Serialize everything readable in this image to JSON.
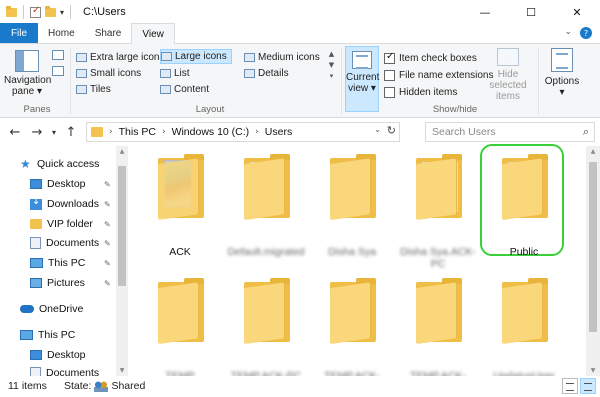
{
  "window": {
    "title": "C:\\Users",
    "minimize_glyph": "—",
    "maximize_glyph": "☐",
    "close_glyph": "✕"
  },
  "ribbon_tabs": [
    "File",
    "Home",
    "Share",
    "View"
  ],
  "active_tab": "View",
  "accent_color": "#1979ca",
  "ribbon": {
    "panes": {
      "nav_pane_label": "Navigation pane ▾",
      "group_label": "Panes"
    },
    "layout": {
      "group_label": "Layout",
      "options": [
        "Extra large icons",
        "Large icons",
        "Medium icons",
        "Small icons",
        "List",
        "Details",
        "Tiles",
        "Content"
      ],
      "selected": "Large icons"
    },
    "current_view": {
      "label": "Current view ▾"
    },
    "show_hide": {
      "group_label": "Show/hide",
      "item_check_boxes": "Item check boxes",
      "item_check_boxes_checked": true,
      "file_name_extensions": "File name extensions",
      "file_name_extensions_checked": false,
      "hidden_items": "Hidden items",
      "hidden_items_checked": false,
      "hide_selected_label": "Hide selected items"
    },
    "options_label": "Options ▾"
  },
  "address": {
    "crumbs": [
      "This PC",
      "Windows 10 (C:)",
      "Users"
    ],
    "back_glyph": "←",
    "forward_glyph": "→",
    "recent_glyph": "▾",
    "up_glyph": "↑",
    "search_placeholder": "Search Users"
  },
  "nav_tree": {
    "items": [
      {
        "label": "Quick access",
        "icon": "star-icon"
      },
      {
        "label": "Desktop",
        "icon": "desktop-icon",
        "pinned": true
      },
      {
        "label": "Downloads",
        "icon": "downloads-icon",
        "pinned": true
      },
      {
        "label": "VIP folder",
        "icon": "folder-icon",
        "pinned": true
      },
      {
        "label": "Documents",
        "icon": "documents-icon",
        "pinned": true
      },
      {
        "label": "This PC",
        "icon": "computer-icon",
        "pinned": true
      },
      {
        "label": "Pictures",
        "icon": "pictures-icon",
        "pinned": true
      },
      {
        "label": "OneDrive",
        "icon": "onedrive-icon"
      },
      {
        "label": "This PC",
        "icon": "computer-icon"
      },
      {
        "label": "Desktop",
        "icon": "desktop-icon"
      },
      {
        "label": "Documents",
        "icon": "documents-icon"
      }
    ],
    "pin_glyph": "📌"
  },
  "files": [
    {
      "name": "ACK",
      "thumb": "photo",
      "blurred": false
    },
    {
      "name": "Default.migrated",
      "thumb": "paper",
      "blurred": true
    },
    {
      "name": "Disha Sya",
      "thumb": "plain",
      "blurred": true
    },
    {
      "name": "Disha Sya.ACK-PC",
      "thumb": "papers",
      "blurred": true
    },
    {
      "name": "Public",
      "thumb": "paper",
      "blurred": false,
      "highlighted": true
    },
    {
      "name": "TEMP",
      "thumb": "plain",
      "blurred": true
    },
    {
      "name": "TEMP.ACK-PC",
      "thumb": "plain",
      "blurred": true
    },
    {
      "name": "TEMP.ACK-PC.000",
      "thumb": "plain",
      "blurred": true
    },
    {
      "name": "TEMP.ACK-PC.001",
      "thumb": "plain",
      "blurred": true
    },
    {
      "name": "UpdatusUser",
      "thumb": "plain",
      "blurred": true
    }
  ],
  "highlight_color": "#39d13a",
  "status": {
    "item_count": "11 items",
    "state_label": "State:",
    "state_value": "Shared"
  }
}
